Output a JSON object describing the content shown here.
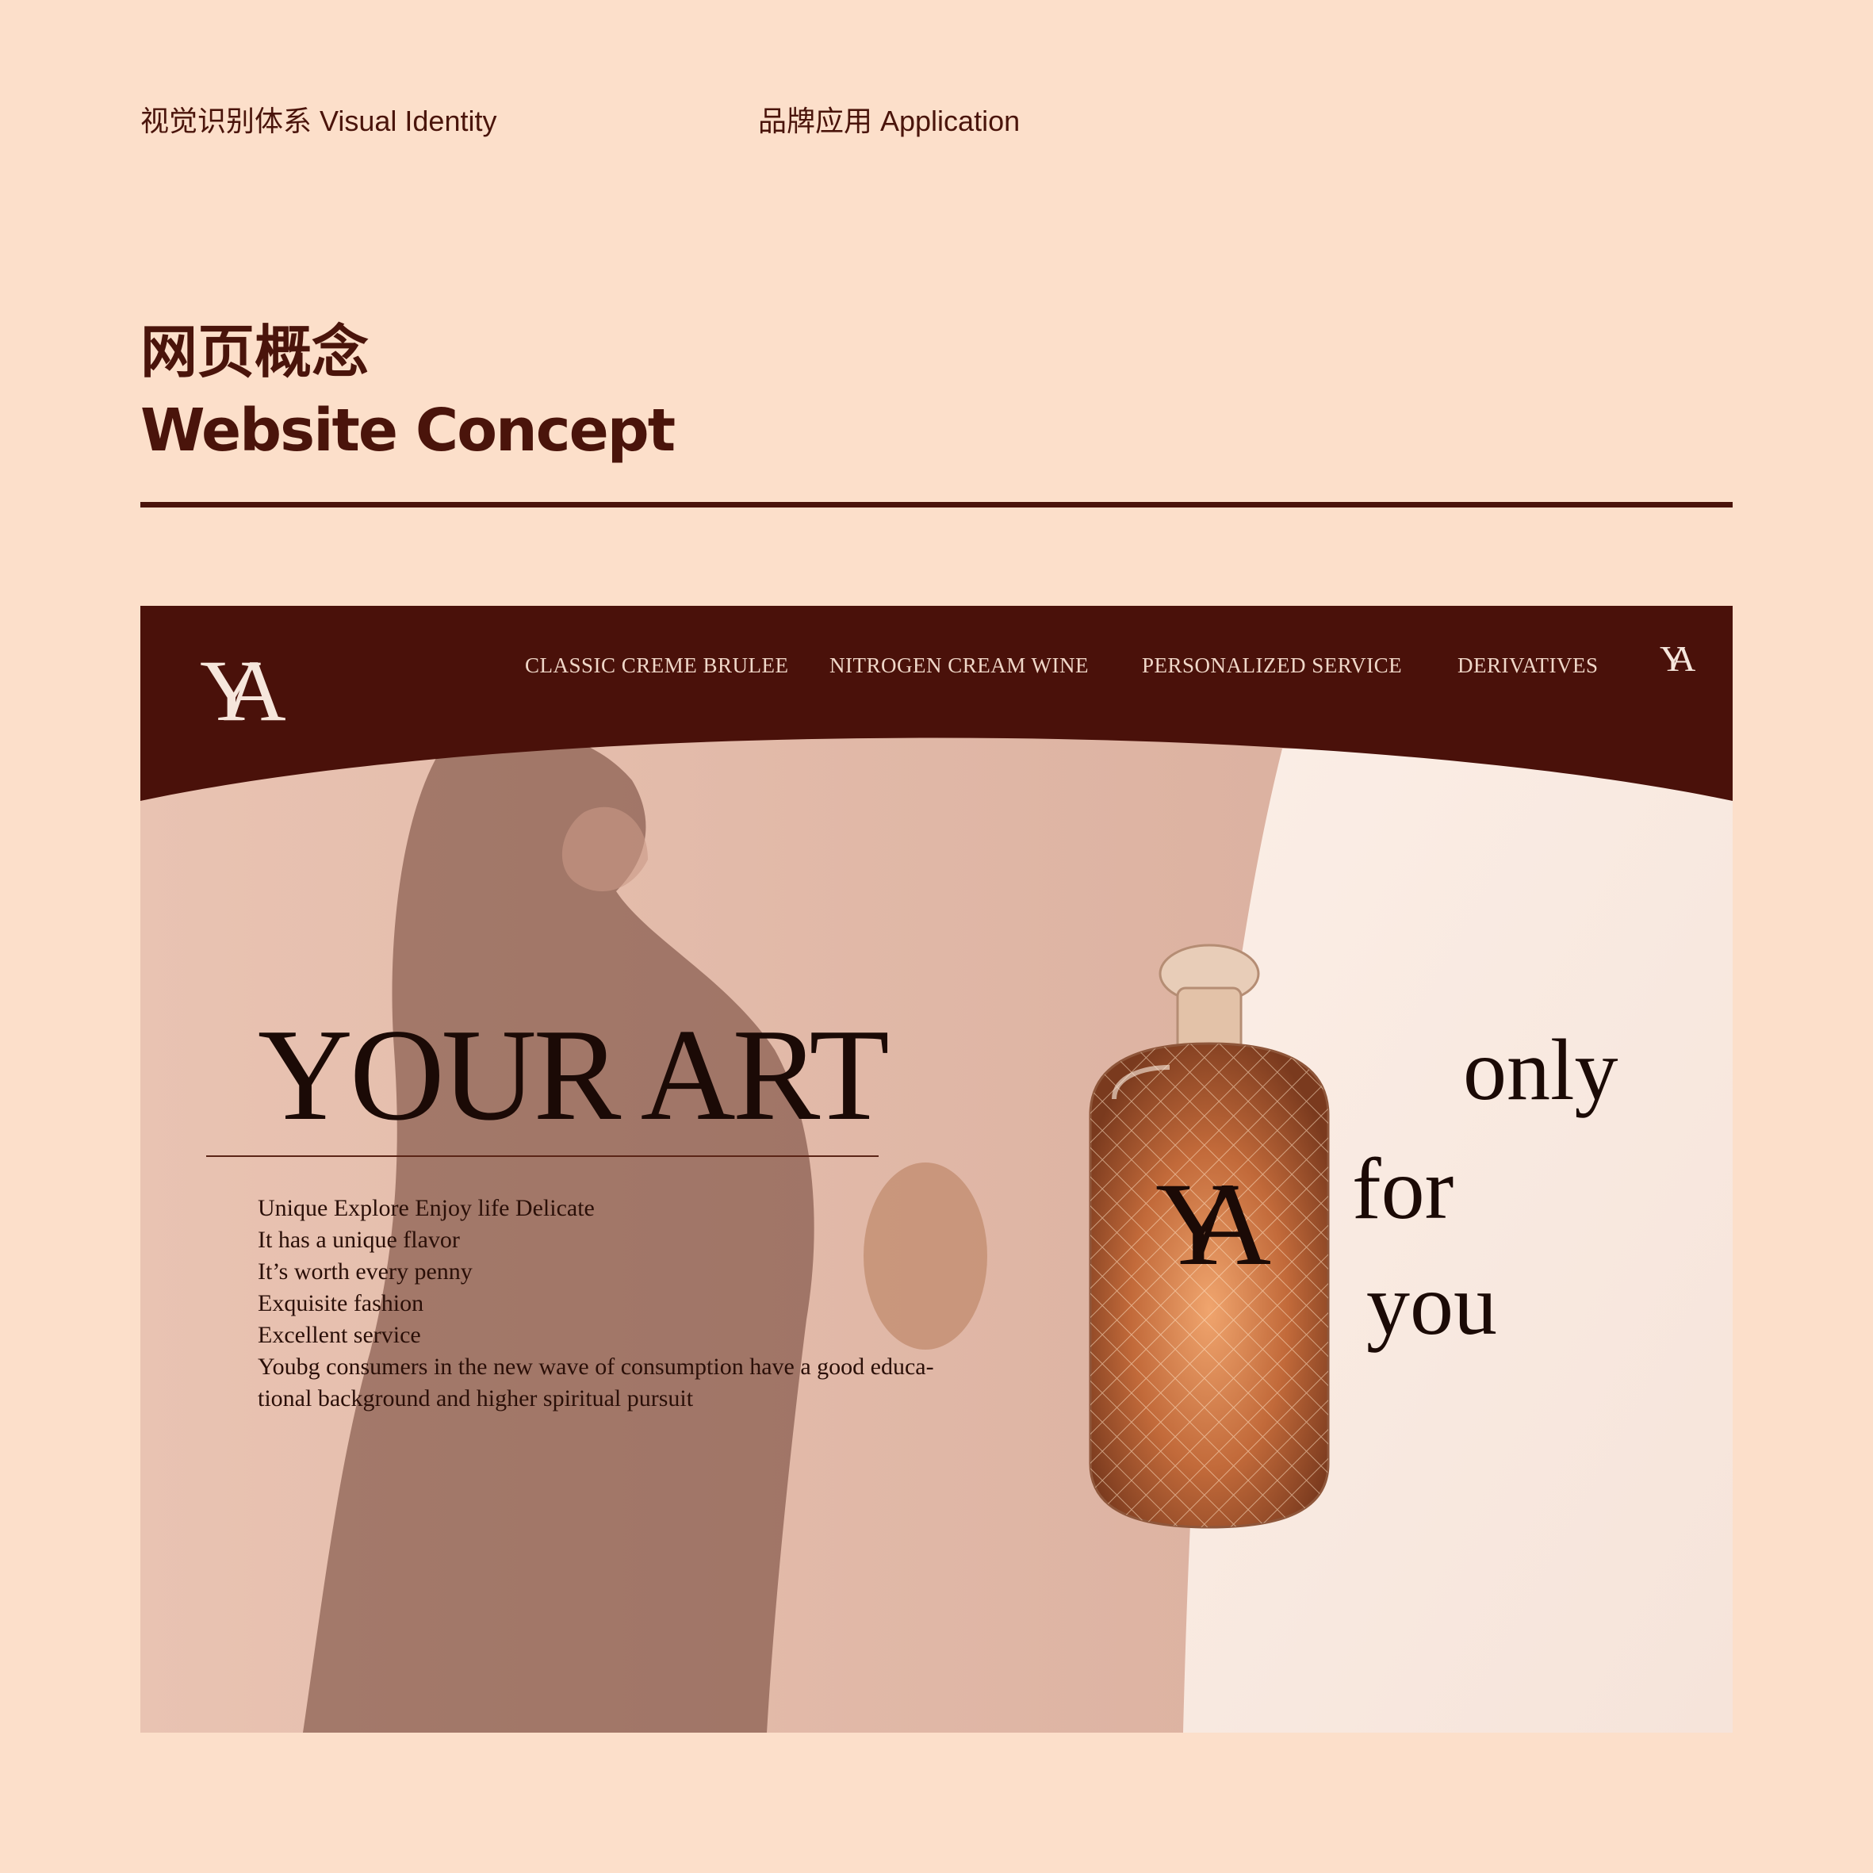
{
  "header": {
    "visual_identity": "视觉识别体系 Visual Identity",
    "application": "品牌应用 Application"
  },
  "title": {
    "zh": "网页概念",
    "en": "Website Concept"
  },
  "website": {
    "logo": "YA",
    "nav": {
      "items": [
        "CLASSIC CREME BRULEE",
        "NITROGEN CREAM WINE",
        "PERSONALIZED SERVICE",
        "DERIVATIVES"
      ],
      "logo_small": "YA"
    },
    "hero": {
      "heading": "YOUR ART",
      "lines": [
        "Unique Explore Enjoy life Delicate",
        "It has a unique flavor",
        "It’s worth every penny",
        "Exquisite fashion",
        "Excellent service",
        "Youbg consumers in the new wave of consumption have a good educa-",
        "tional background and higher spiritual pursuit"
      ],
      "tagline": [
        "only",
        "for",
        "you"
      ],
      "bottle_logo": "YA"
    }
  },
  "colors": {
    "background": "#fcdfca",
    "brand_dark": "#4a140b",
    "nav_text": "#f0d7c8",
    "hero_text": "#1b0a06"
  }
}
